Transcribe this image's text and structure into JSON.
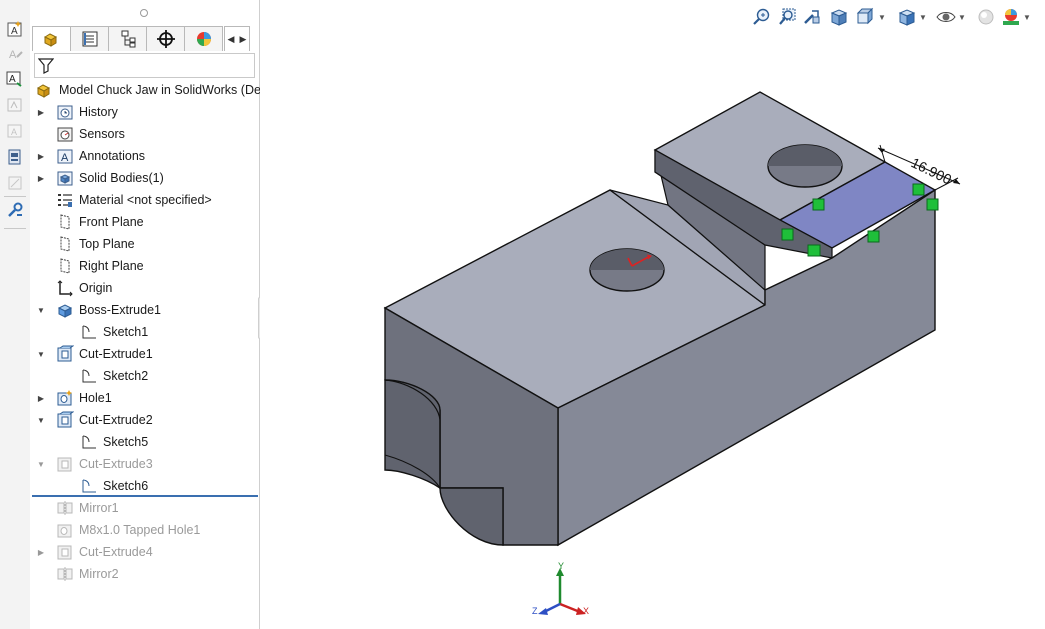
{
  "feature_tree": {
    "root_label": "Model Chuck Jaw in SolidWorks  (Defa",
    "items": [
      {
        "label": "History",
        "icon": "history-icon"
      },
      {
        "label": "Sensors",
        "icon": "sensors-icon"
      },
      {
        "label": "Annotations",
        "icon": "annotations-icon"
      },
      {
        "label": "Solid Bodies(1)",
        "icon": "solid-bodies-icon"
      },
      {
        "label": "Material <not specified>",
        "icon": "material-icon"
      },
      {
        "label": "Front Plane",
        "icon": "plane-icon"
      },
      {
        "label": "Top Plane",
        "icon": "plane-icon"
      },
      {
        "label": "Right Plane",
        "icon": "plane-icon"
      },
      {
        "label": "Origin",
        "icon": "origin-icon"
      },
      {
        "label": "Boss-Extrude1",
        "icon": "boss-extrude-icon"
      },
      {
        "label": "Sketch1",
        "icon": "sketch-icon"
      },
      {
        "label": "Cut-Extrude1",
        "icon": "cut-extrude-icon"
      },
      {
        "label": "Sketch2",
        "icon": "sketch-icon"
      },
      {
        "label": "Hole1",
        "icon": "hole-icon"
      },
      {
        "label": "Cut-Extrude2",
        "icon": "cut-extrude-icon"
      },
      {
        "label": "Sketch5",
        "icon": "sketch-icon"
      },
      {
        "label": "Cut-Extrude3",
        "icon": "cut-extrude-icon"
      },
      {
        "label": "Sketch6",
        "icon": "sketch-icon"
      },
      {
        "label": "Mirror1",
        "icon": "mirror-icon"
      },
      {
        "label": "M8x1.0 Tapped Hole1",
        "icon": "tapped-hole-icon"
      },
      {
        "label": "Cut-Extrude4",
        "icon": "cut-extrude-icon"
      },
      {
        "label": "Mirror2",
        "icon": "mirror-icon"
      }
    ]
  },
  "tabs": [
    "feature-manager-tab",
    "property-manager-tab",
    "configuration-manager-tab",
    "dimxpert-manager-tab",
    "display-manager-tab"
  ],
  "viewport": {
    "dimension_value": "16.900",
    "triad": {
      "x": "X",
      "y": "Y",
      "z": "Z"
    }
  },
  "colors": {
    "part_top": "#a9adbb",
    "part_side": "#858997",
    "part_front": "#6e717d",
    "selected_face": "#7f86c4",
    "sketch_relation": "#1fbf3a",
    "rollback_bar": "#3a6fb0"
  }
}
